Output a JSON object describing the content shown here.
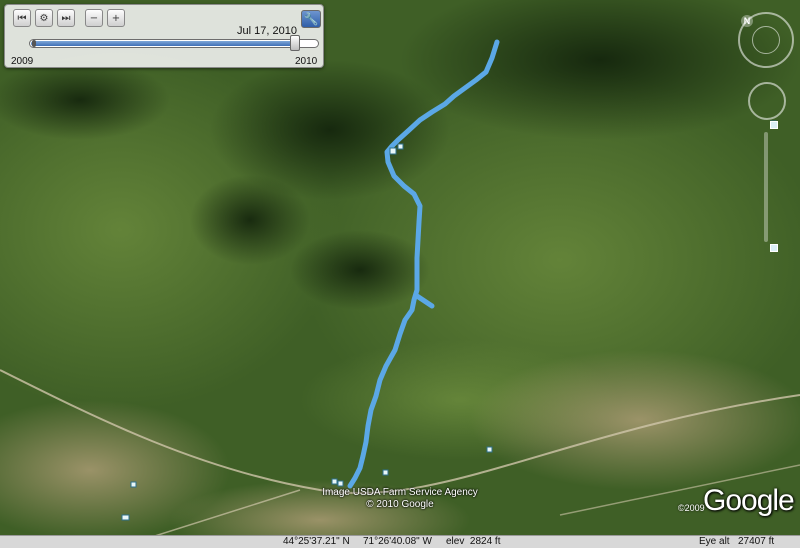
{
  "map": {
    "trail_color": "#5ba8e6",
    "imagery": "satellite-forest-valley"
  },
  "time_slider": {
    "date": "Jul 17, 2010",
    "range_start": "2009",
    "range_end": "2010",
    "position_fraction": 0.92,
    "buttons": [
      "rewind-icon",
      "settings-gear-icon",
      "forward-icon",
      "zoom-out-icon",
      "zoom-in-icon",
      "wrench-icon"
    ]
  },
  "navigation": {
    "north_label": "N"
  },
  "credits": {
    "line1": "Image USDA Farm Service Agency",
    "line2": "© 2010 Google"
  },
  "logo": {
    "year": "©2009",
    "text": "Google"
  },
  "status": {
    "lat": "44°25'37.21\" N",
    "lon": "71°26'40.08\" W",
    "elev": "elev  2824 ft",
    "eye_label": "Eye alt",
    "eye_value": "27407 ft"
  }
}
